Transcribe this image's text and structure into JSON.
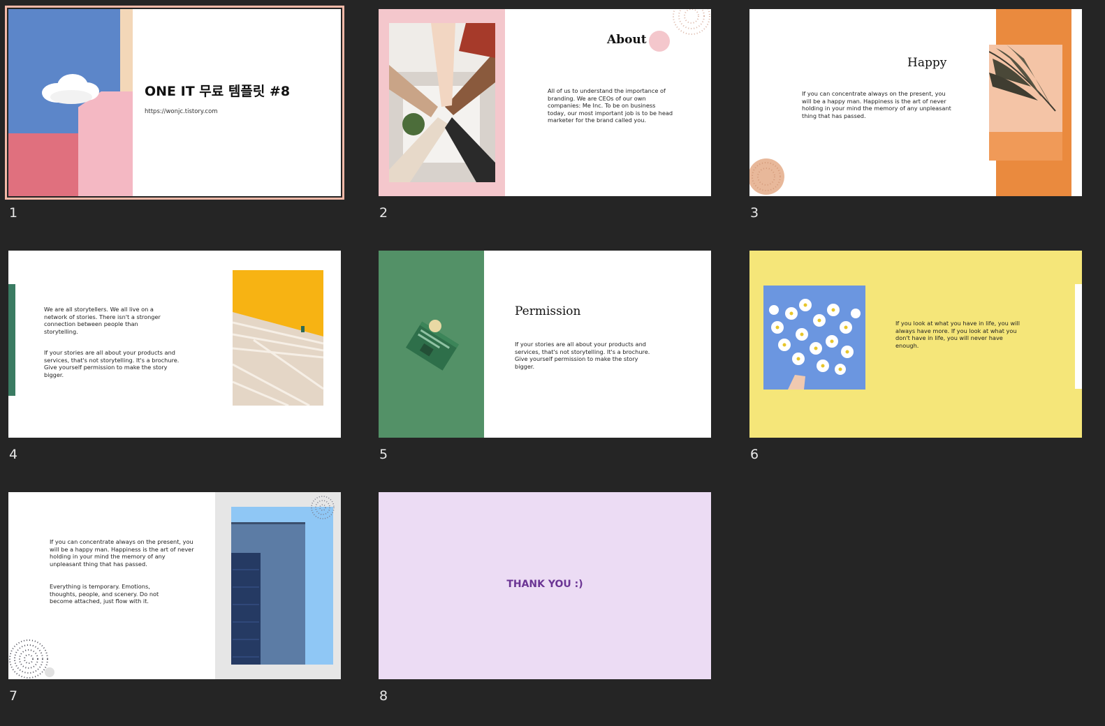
{
  "slides": [
    {
      "number": "1",
      "title": "ONE IT 무료 템플릿 #8",
      "url": "https://wonjc.tistory.com"
    },
    {
      "number": "2",
      "title": "About",
      "text": "All of us to understand the importance of branding. We are CEOs of our own companies: Me Inc. To be on business today, our most important job is to be head marketer for the brand called you."
    },
    {
      "number": "3",
      "title": "Happy",
      "text": "If you can concentrate always on the present, you will be a happy man. Happiness is the art of never holding in your mind the memory of any unpleasant thing that has passed."
    },
    {
      "number": "4",
      "text1": "We are all storytellers. We all live on a network of stories. There isn't a stronger connection between people than storytelling.",
      "text2": "If your stories are all about your products and services, that's not storytelling. It's a brochure. Give yourself permission to make the story bigger."
    },
    {
      "number": "5",
      "title": "Permission",
      "text": "If your stories are all about your products and services, that's not storytelling. It's a brochure. Give yourself permission to make the story bigger."
    },
    {
      "number": "6",
      "text": "If you look at what you have in life, you will always have more. If you look at what you don't have in life, you will never have enough."
    },
    {
      "number": "7",
      "text1": "If you can concentrate always on the present, you will be a happy man. Happiness is the art of never holding in your mind the memory of any unpleasant thing that has passed.",
      "text2": "Everything is temporary. Emotions, thoughts, people, and scenery. Do not become attached, just flow with it."
    },
    {
      "number": "8",
      "text": "THANK YOU :)"
    }
  ],
  "colors": {
    "background": "#252525",
    "selected_outline": "#f4b9a8",
    "slide2_pink": "#f4c7cc",
    "slide3_orange": "#ea8a3e",
    "slide4_green": "#3a7b62",
    "slide5_green": "#539167",
    "slide6_yellow": "#f5e679",
    "slide8_lavender": "#ecdcf4",
    "slide8_text": "#6b3594"
  },
  "selected_slide": "1"
}
